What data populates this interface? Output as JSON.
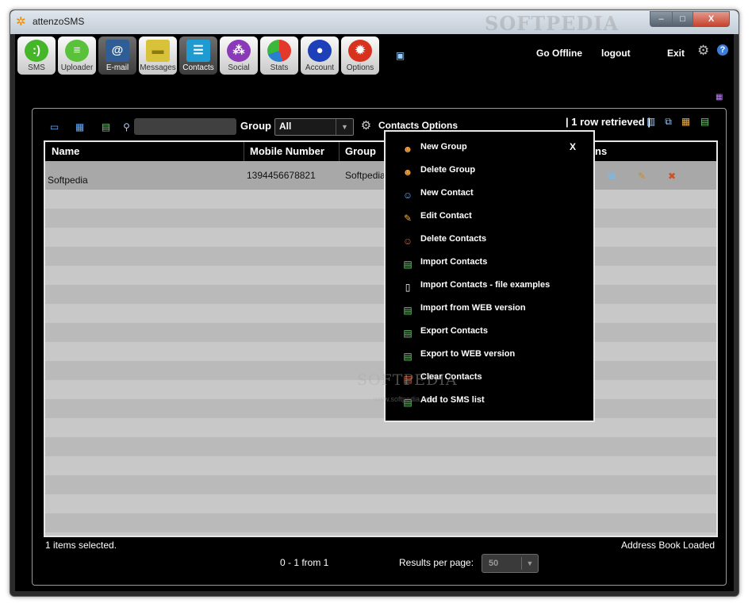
{
  "window": {
    "title": "attenzoSMS",
    "watermark": "SOFTPEDIA",
    "controls": {
      "minimize": "–",
      "maximize": "□",
      "close": "X"
    }
  },
  "colors": {
    "accent": "#3b7dd8",
    "panel_bg": "#000000",
    "selected_row": "#a8a8a8",
    "menu_border": "#e8e8e8"
  },
  "toolbar": {
    "buttons": [
      {
        "label": "SMS",
        "icon": "sms-bubble-icon"
      },
      {
        "label": "Uploader",
        "icon": "uploader-bubble-icon"
      },
      {
        "label": "E-mail",
        "icon": "email-envelope-icon"
      },
      {
        "label": "Messages",
        "icon": "messages-icon"
      },
      {
        "label": "Contacts",
        "icon": "contacts-book-icon"
      },
      {
        "label": "Social",
        "icon": "social-icon"
      },
      {
        "label": "Stats",
        "icon": "stats-pie-icon"
      },
      {
        "label": "Account",
        "icon": "account-user-icon"
      },
      {
        "label": "Options",
        "icon": "options-gear-icon"
      }
    ],
    "links": {
      "offline": "Go Offline",
      "logout": "logout",
      "exit": "Exit"
    }
  },
  "contacts": {
    "search": {
      "value": "",
      "placeholder": ""
    },
    "group_label": "Group",
    "group_select": "All",
    "options_label": "Contacts Options",
    "rows_retrieved": "| 1 row retrieved |",
    "columns": [
      "Name",
      "Mobile Number",
      "Group",
      "ns"
    ],
    "rows": [
      {
        "name": "Softpedia",
        "mobile": "1394456678821",
        "group": "Softpedia"
      }
    ],
    "status_left": "1 items selected.",
    "status_right": "Address Book Loaded",
    "pager": "0 - 1 from 1",
    "results_per_page_label": "Results per page:",
    "results_per_page": "50"
  },
  "menu": {
    "close": "X",
    "items": [
      {
        "label": "New Group",
        "icon": "new-group-icon"
      },
      {
        "label": "Delete Group",
        "icon": "delete-group-icon"
      },
      {
        "label": "New Contact",
        "icon": "new-contact-icon"
      },
      {
        "label": "Edit Contact",
        "icon": "edit-contact-icon"
      },
      {
        "label": "Delete Contacts",
        "icon": "delete-contacts-icon"
      },
      {
        "label": "Import Contacts",
        "icon": "import-contacts-icon"
      },
      {
        "label": "Import Contacts - file examples",
        "icon": "file-examples-icon"
      },
      {
        "label": "Import from WEB version",
        "icon": "import-web-icon"
      },
      {
        "label": "Export Contacts",
        "icon": "export-contacts-icon"
      },
      {
        "label": "Export to WEB version",
        "icon": "export-web-icon"
      },
      {
        "label": "Clear Contacts",
        "icon": "clear-contacts-icon"
      },
      {
        "label": "Add to SMS list",
        "icon": "add-sms-list-icon"
      }
    ],
    "watermark": "SOFTPEDIA",
    "watermark_url": "www.softpedia.com"
  }
}
